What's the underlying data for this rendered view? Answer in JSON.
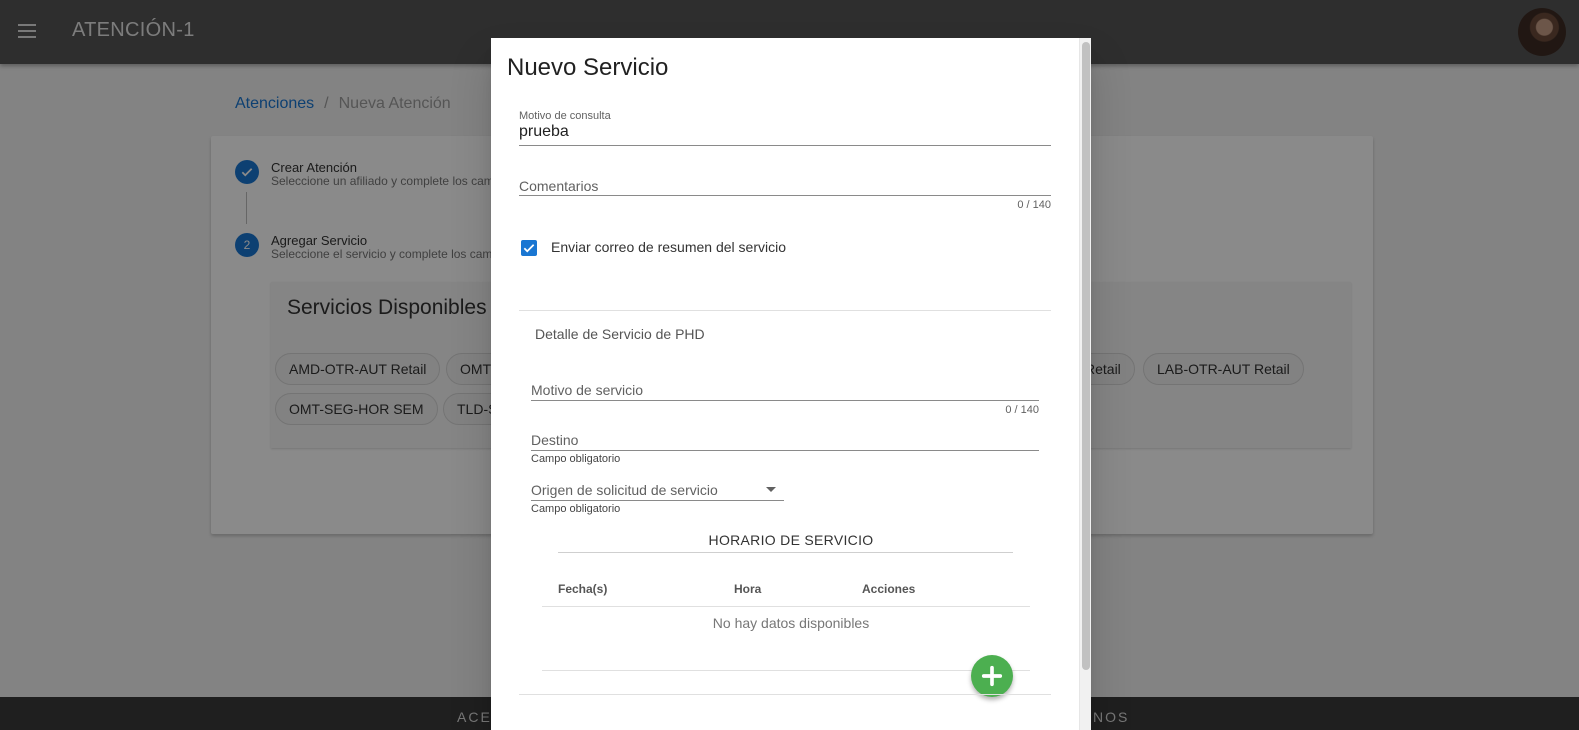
{
  "app": {
    "title": "ATENCIÓN-1",
    "menu_icon": "hamburger-icon",
    "avatar_icon": "user-avatar"
  },
  "breadcrumb": {
    "link": "Atenciones",
    "separator": "/",
    "current": "Nueva Atención"
  },
  "stepper": {
    "steps": [
      {
        "number": "✓",
        "title": "Crear Atención",
        "subtitle": "Seleccione un afiliado y complete los cam"
      },
      {
        "number": "2",
        "title": "Agregar Servicio",
        "subtitle": "Seleccione el servicio y complete los cam"
      }
    ]
  },
  "services": {
    "title": "Servicios Disponibles",
    "chips": [
      "AMD-OTR-AUT Retail",
      "OMT-",
      "Retail",
      "LAB-OTR-AUT Retail",
      "OMT-SEG-HOR SEM",
      "TLD-S"
    ]
  },
  "footer": {
    "left_text": "ACE",
    "right_text": "NOS"
  },
  "dialog": {
    "title": "Nuevo Servicio",
    "motivo_consulta": {
      "label": "Motivo de consulta",
      "value": "prueba"
    },
    "comentarios": {
      "label": "Comentarios",
      "counter": "0 / 140"
    },
    "email_checkbox": {
      "label": "Enviar correo de resumen del servicio",
      "checked": true
    },
    "detalle_title": "Detalle de Servicio de PHD",
    "motivo_servicio": {
      "label": "Motivo de servicio",
      "counter": "0 / 140"
    },
    "destino": {
      "label": "Destino",
      "hint": "Campo obligatorio"
    },
    "origen": {
      "label": "Origen de solicitud de servicio",
      "hint": "Campo obligatorio"
    },
    "horario": {
      "title": "HORARIO DE SERVICIO",
      "headers": [
        "Fecha(s)",
        "Hora",
        "Acciones"
      ],
      "empty": "No hay datos disponibles"
    },
    "add_button_icon": "plus-icon"
  },
  "colors": {
    "primary": "#1976d2",
    "fab": "#4caf50",
    "appbar": "#555555"
  }
}
